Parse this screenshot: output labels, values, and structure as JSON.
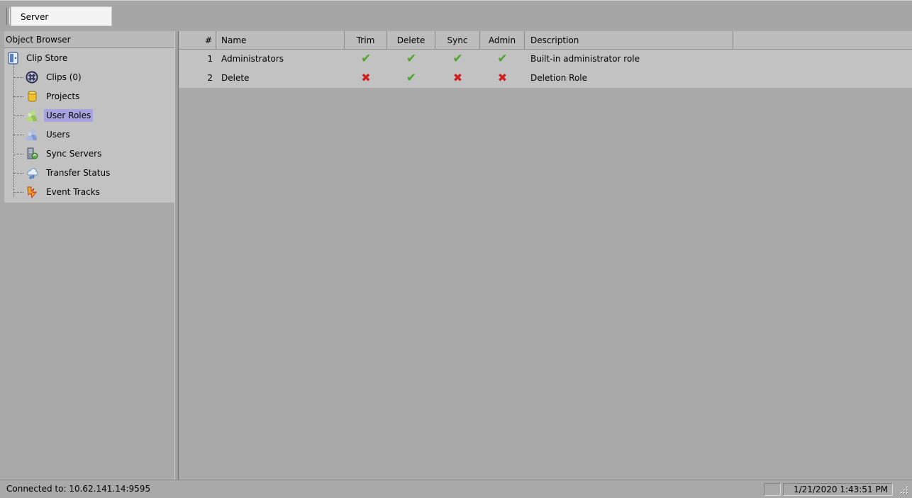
{
  "toolbar": {
    "server_tab": "Server"
  },
  "object_browser": {
    "header": "Object Browser",
    "root": {
      "label": "Clip Store",
      "icon": "clip-store-icon"
    },
    "items": [
      {
        "label": "Clips (0)",
        "icon": "clips-reel-icon"
      },
      {
        "label": "Projects",
        "icon": "projects-cylinder-icon"
      },
      {
        "label": "User Roles",
        "icon": "user-roles-icon",
        "selected": true
      },
      {
        "label": "Users",
        "icon": "users-icon"
      },
      {
        "label": "Sync Servers",
        "icon": "sync-servers-icon"
      },
      {
        "label": "Transfer Status",
        "icon": "transfer-status-icon"
      },
      {
        "label": "Event Tracks",
        "icon": "event-tracks-icon"
      }
    ]
  },
  "grid": {
    "columns": [
      "#",
      "Name",
      "Trim",
      "Delete",
      "Sync",
      "Admin",
      "Description"
    ],
    "rows": [
      {
        "num": "1",
        "name": "Administrators",
        "trim": true,
        "delete": true,
        "sync": true,
        "admin": true,
        "description": "Built-in administrator role"
      },
      {
        "num": "2",
        "name": "Delete",
        "trim": false,
        "delete": true,
        "sync": false,
        "admin": false,
        "description": "Deletion Role"
      }
    ]
  },
  "status": {
    "connection": "Connected to: 10.62.141.14:9595",
    "datetime": "1/21/2020 1:43:51 PM"
  },
  "colors": {
    "selection": "#a7a3de",
    "check": "#4aa62a",
    "cross": "#d01e1e"
  }
}
